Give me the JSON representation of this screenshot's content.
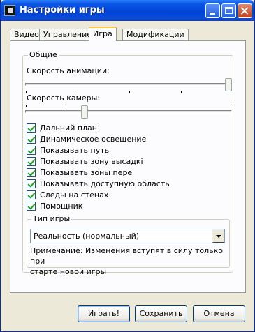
{
  "window": {
    "title": "Настройки игры",
    "title_color": "#ffffff",
    "accent": "#0a55e6"
  },
  "tabs": [
    {
      "label": "Видео",
      "active": false
    },
    {
      "label": "Управление",
      "active": false
    },
    {
      "label": "Игра",
      "active": true
    },
    {
      "label": "Модификации",
      "active": false
    }
  ],
  "general": {
    "legend": "Общие",
    "animation_speed": {
      "label": "Скорость анимации:",
      "value_fraction": 1.0
    },
    "camera_speed": {
      "label": "Скорость камеры:",
      "value_fraction": 0.28
    },
    "checkboxes": [
      {
        "label": "Дальний план",
        "checked": true
      },
      {
        "label": "Динамическое освещение",
        "checked": true
      },
      {
        "label": "Показывать путь",
        "checked": true
      },
      {
        "label": "Показывать зону высадкі",
        "checked": true
      },
      {
        "label": "Показывать зоны пере",
        "checked": true
      },
      {
        "label": "Показывать доступную область",
        "checked": true
      },
      {
        "label": "Следы на стенах",
        "checked": true
      },
      {
        "label": "Помощник",
        "checked": true
      }
    ],
    "game_type": {
      "legend": "Тип игры",
      "selected": "Реальность (нормальный)",
      "note_line1": "Примечание: Изменения вступят в силу только при",
      "note_line2": "старте новой игры"
    }
  },
  "buttons": {
    "play": "Играть!",
    "save": "Сохранить",
    "cancel": "Отмена"
  }
}
